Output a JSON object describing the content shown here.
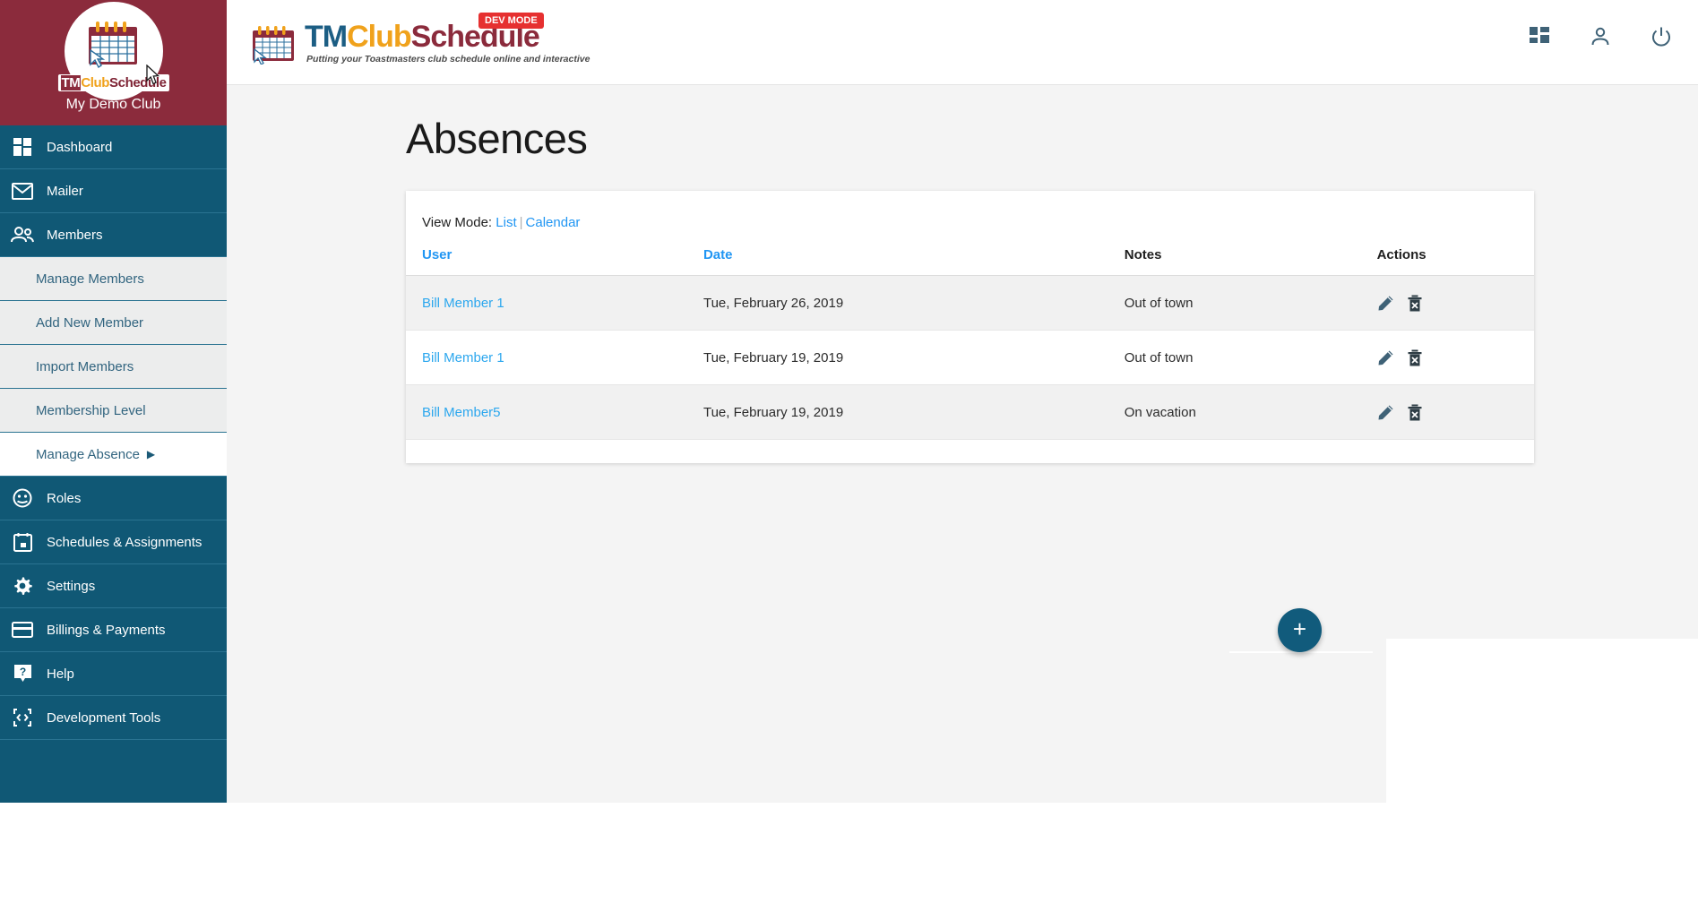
{
  "brand": {
    "wordmark_tm": "TM",
    "wordmark_club": "Club",
    "wordmark_schedule": "Schedule",
    "club_name": "My Demo Club",
    "logo_icon": "calendar-icon"
  },
  "header": {
    "logo_tm": "TM",
    "logo_club": "Club",
    "logo_schedule": "Schedule",
    "tagline": "Putting your Toastmasters club schedule online and interactive",
    "dev_badge": "DEV MODE",
    "icons": [
      {
        "name": "dashboard-grid-icon",
        "label": "Dashboard"
      },
      {
        "name": "user-account-icon",
        "label": "Account"
      },
      {
        "name": "power-logout-icon",
        "label": "Logout"
      }
    ]
  },
  "sidebar": {
    "items": [
      {
        "label": "Dashboard",
        "icon": "dashboard-grid-icon"
      },
      {
        "label": "Mailer",
        "icon": "envelope-icon"
      },
      {
        "label": "Members",
        "icon": "people-icon"
      }
    ],
    "submenu": [
      {
        "label": "Manage Members",
        "active": false
      },
      {
        "label": "Add New Member",
        "active": false
      },
      {
        "label": "Import Members",
        "active": false
      },
      {
        "label": "Membership Level",
        "active": false
      },
      {
        "label": "Manage Absence",
        "active": true,
        "arrow": "▶"
      }
    ],
    "items_after": [
      {
        "label": "Roles",
        "icon": "role-face-icon"
      },
      {
        "label": "Schedules & Assignments",
        "icon": "calendar-icon"
      },
      {
        "label": "Settings",
        "icon": "gear-icon"
      },
      {
        "label": "Billings & Payments",
        "icon": "credit-card-icon"
      },
      {
        "label": "Help",
        "icon": "question-help-icon"
      },
      {
        "label": "Development Tools",
        "icon": "code-brackets-icon"
      }
    ]
  },
  "main": {
    "page_title": "Absences",
    "view_mode": {
      "label": "View Mode:",
      "list": "List",
      "separator": "|",
      "calendar": "Calendar"
    },
    "table": {
      "headers": [
        {
          "label": "User",
          "sortable": true
        },
        {
          "label": "Date",
          "sortable": true
        },
        {
          "label": "Notes",
          "sortable": false
        },
        {
          "label": "Actions",
          "sortable": false
        }
      ],
      "rows": [
        {
          "user": "Bill Member 1",
          "date": "Tue, February 26, 2019",
          "notes": "Out of town"
        },
        {
          "user": "Bill Member 1",
          "date": "Tue, February 19, 2019",
          "notes": "Out of town"
        },
        {
          "user": "Bill Member5",
          "date": "Tue, February 19, 2019",
          "notes": "On vacation"
        }
      ],
      "action_icons": [
        {
          "name": "edit-pencil-icon",
          "label": "Edit"
        },
        {
          "name": "delete-trash-icon",
          "label": "Delete"
        }
      ]
    },
    "fab": {
      "label": "+",
      "name": "add-absence-button"
    }
  },
  "colors": {
    "sidebar": "#105875",
    "brand_maroon": "#8B2B3C",
    "accent_link": "#2196F3",
    "row_link": "#2CA7EE",
    "fab": "#115B7C",
    "dev_badge": "#E63030",
    "logo_orange": "#F0A21C",
    "logo_blue": "#1C5E84",
    "page_bg": "#F4F4F4"
  }
}
